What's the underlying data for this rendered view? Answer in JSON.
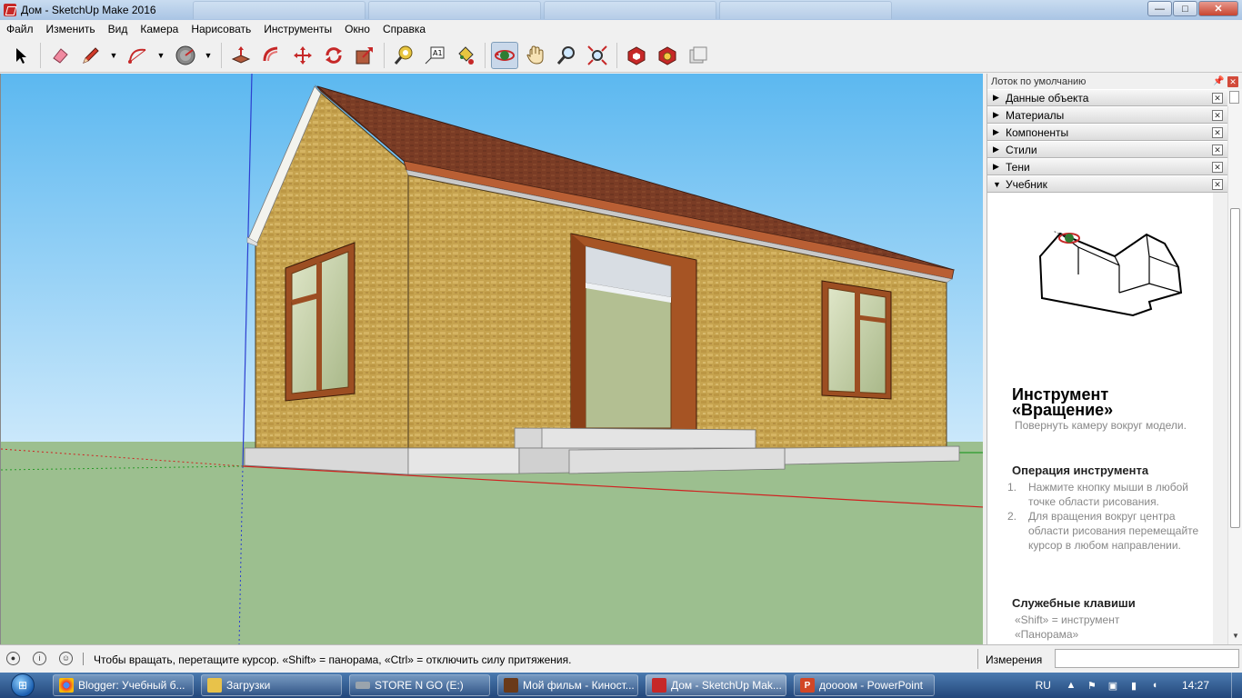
{
  "window": {
    "title": "Дом - SketchUp Make 2016",
    "buttons": {
      "minimize": "—",
      "maximize": "□",
      "close": "✕"
    }
  },
  "menu": [
    "Файл",
    "Изменить",
    "Вид",
    "Камера",
    "Нарисовать",
    "Инструменты",
    "Окно",
    "Справка"
  ],
  "toolbar": {
    "tools": [
      "select",
      "eraser",
      "pencil",
      "arc",
      "shapes",
      "push-pull",
      "follow-me",
      "move",
      "rotate",
      "scale",
      "tape-measure",
      "text",
      "paint-bucket",
      "orbit",
      "pan",
      "zoom",
      "zoom-extents",
      "warehouse",
      "extension-warehouse",
      "send-to-layout"
    ],
    "active_tool": "orbit"
  },
  "tray": {
    "title": "Лоток по умолчанию",
    "panels": [
      {
        "label": "Данные объекта",
        "expanded": false
      },
      {
        "label": "Материалы",
        "expanded": false
      },
      {
        "label": "Компоненты",
        "expanded": false
      },
      {
        "label": "Стили",
        "expanded": false
      },
      {
        "label": "Тени",
        "expanded": false
      },
      {
        "label": "Учебник",
        "expanded": true
      }
    ],
    "instructor": {
      "title": "Инструмент «Вращение»",
      "subtitle": "Повернуть камеру вокруг модели.",
      "operation_heading": "Операция инструмента",
      "steps": [
        {
          "num": "1.",
          "text": "Нажмите кнопку мыши в любой точке области рисования."
        },
        {
          "num": "2.",
          "text": "Для вращения вокруг центра области рисования перемещайте курсор в любом направлении."
        }
      ],
      "keys_heading": "Служебные клавиши",
      "keys_text": "«Shift» = инструмент «Панорама»"
    }
  },
  "statusbar": {
    "message": "Чтобы вращать, перетащите курсор. «Shift» = панорама, «Ctrl» = отключить силу притяжения.",
    "measurements_label": "Измерения",
    "measurements_value": ""
  },
  "taskbar": {
    "tasks": [
      {
        "label": "Blogger: Учебный б...",
        "icon": "chrome-icon",
        "active": false
      },
      {
        "label": "Загрузки",
        "icon": "folder-icon",
        "active": false
      },
      {
        "label": "STORE N GO (E:)",
        "icon": "drive-icon",
        "active": false
      },
      {
        "label": "Мой фильм - Киност...",
        "icon": "film-icon",
        "active": false
      },
      {
        "label": "Дом - SketchUp Mak...",
        "icon": "sketchup-icon",
        "active": true
      },
      {
        "label": "доооом - PowerPoint",
        "icon": "powerpoint-icon",
        "active": false
      }
    ],
    "language": "RU",
    "time": "14:27"
  },
  "colors": {
    "sky_top": "#6bbdf0",
    "sky_bottom": "#c8e7fb",
    "ground": "#9cbf8f",
    "wall": "#c6a34f",
    "roof": "#7a3c25",
    "trim": "#b55f2c",
    "foundation": "#d8d8d8"
  }
}
